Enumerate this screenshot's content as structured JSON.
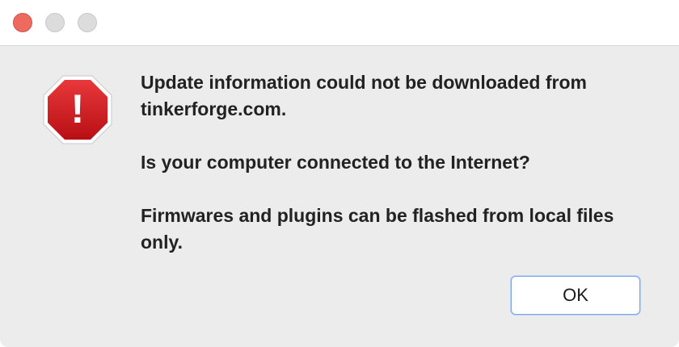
{
  "window": {
    "controls": [
      "close",
      "minimize",
      "maximize"
    ]
  },
  "alert": {
    "icon": "stop-alert-icon",
    "icon_glyph": "!",
    "colors": {
      "icon_red": "#d71f24",
      "focus_ring": "#7aa7e8"
    },
    "messages": [
      "Update information could not be downloaded from tinkerforge.com.",
      "Is your computer connected to the Internet?",
      "Firmwares and plugins can be flashed from local files only."
    ]
  },
  "buttons": {
    "ok_label": "OK"
  }
}
